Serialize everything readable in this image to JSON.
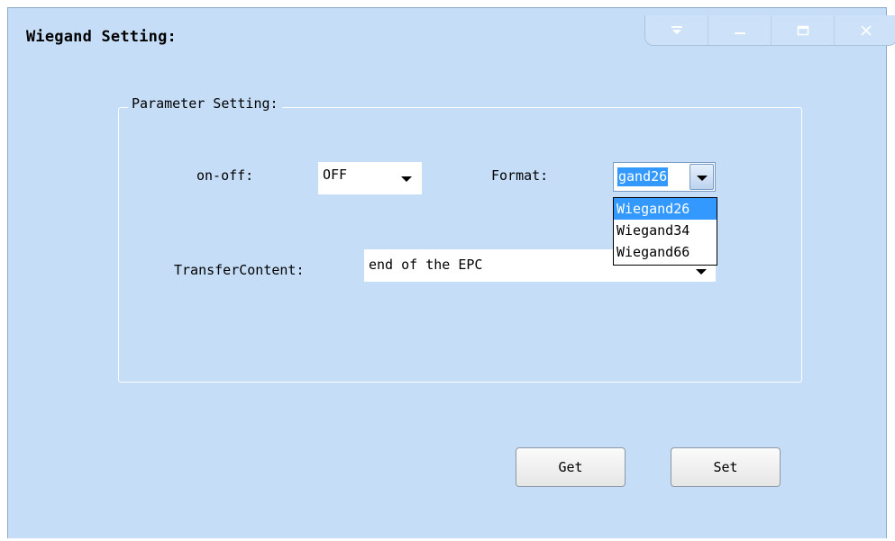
{
  "window": {
    "title": "Wiegand Setting:",
    "controls": [
      "menu-icon",
      "minimize-icon",
      "maximize-icon",
      "close-icon"
    ]
  },
  "group": {
    "label": "Parameter Setting:"
  },
  "onoff": {
    "label": "on-off:",
    "value": "OFF"
  },
  "format": {
    "label": "Format:",
    "value": "gand26",
    "options": [
      "Wiegand26",
      "Wiegand34",
      "Wiegand66"
    ],
    "selected_index": 0
  },
  "transfer": {
    "label": "TransferContent:",
    "value": "end of the EPC"
  },
  "buttons": {
    "get": "Get",
    "set": "Set"
  },
  "colors": {
    "window_bg": "#c5ddf7",
    "selection": "#3399ff"
  }
}
